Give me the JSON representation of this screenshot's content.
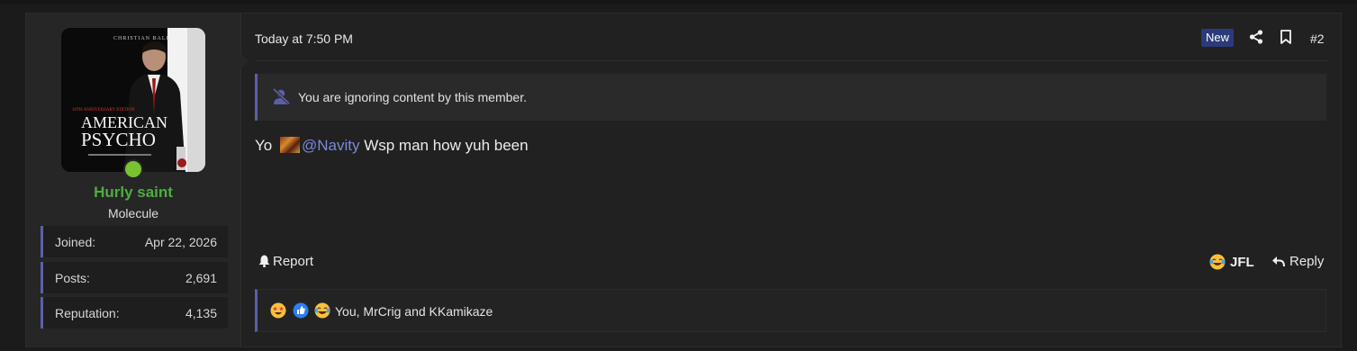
{
  "post": {
    "date": "Today at 7:50 PM",
    "badge": "New",
    "number": "#2",
    "ignore_notice": "You are ignoring content by this member.",
    "message_parts": {
      "before": "Yo",
      "mention": "@Navity",
      "after": "Wsp man how yuh been"
    },
    "actions": {
      "report": "Report",
      "reaction_label": "JFL",
      "reply": "Reply"
    },
    "reactions": {
      "icons": [
        "star-struck-emoji-icon",
        "thumbs-up-icon",
        "laughing-tears-emoji-icon"
      ],
      "summary": "You, MrCrig and KKamikaze"
    }
  },
  "user": {
    "name": "Hurly saint",
    "title": "Molecule",
    "avatar": {
      "top_text": "CHRISTIAN BALE",
      "title_line1": "AMERICAN",
      "title_line2": "PSYCHO",
      "edition": "10TH ANNIVERSARY EDITION"
    },
    "stats": [
      {
        "label": "Joined:",
        "value": "Apr 22, 2026"
      },
      {
        "label": "Posts:",
        "value": "2,691"
      },
      {
        "label": "Reputation:",
        "value": "4,135"
      }
    ]
  },
  "colors": {
    "accent": "#5c5fa8",
    "username": "#4caf3e",
    "online": "#7ac231",
    "mention": "#7d88d8",
    "badge": "#2b3a7a"
  }
}
